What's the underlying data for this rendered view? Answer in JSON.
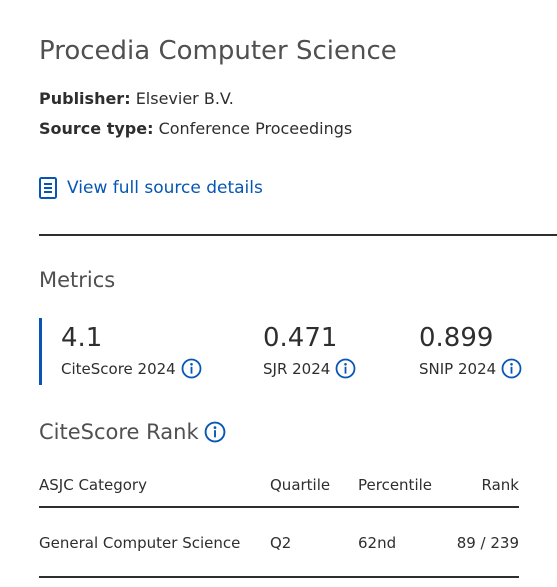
{
  "journal": {
    "title": "Procedia Computer Science",
    "publisher_label": "Publisher:",
    "publisher": "Elsevier B.V.",
    "source_type_label": "Source type:",
    "source_type": "Conference Proceedings",
    "source_link": "View full source details"
  },
  "metrics": {
    "heading": "Metrics",
    "items": [
      {
        "value": "4.1",
        "label": "CiteScore 2024"
      },
      {
        "value": "0.471",
        "label": "SJR 2024"
      },
      {
        "value": "0.899",
        "label": "SNIP 2024"
      }
    ]
  },
  "rank": {
    "heading": "CiteScore Rank",
    "columns": [
      "ASJC Category",
      "Quartile",
      "Percentile",
      "Rank"
    ],
    "rows": [
      {
        "category": "General Computer Science",
        "quartile": "Q2",
        "percentile": "62nd",
        "rank": "89 / 239"
      }
    ]
  },
  "colors": {
    "accent": "#0656b4",
    "text": "#2e2e2e",
    "heading": "#505050"
  },
  "icons": {
    "source_link": "document-icon",
    "info": "info-icon"
  }
}
